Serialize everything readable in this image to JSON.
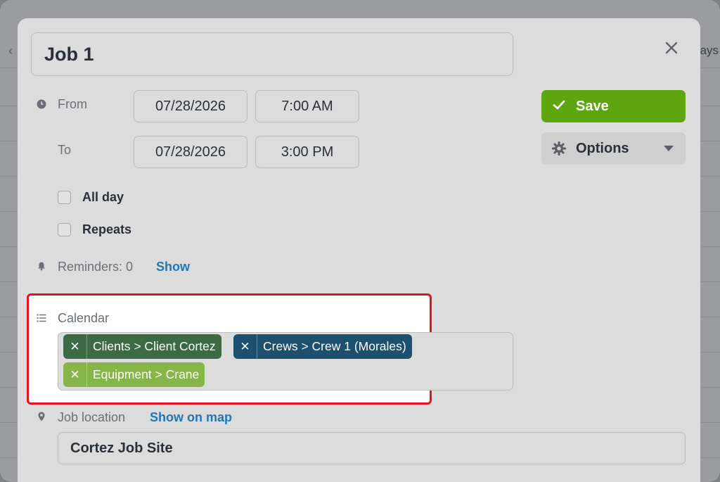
{
  "background": {
    "right_text": "ays"
  },
  "dialog": {
    "title": "Job 1",
    "from_label": "From",
    "to_label": "To",
    "from_date": "07/28/2026",
    "from_time": "7:00 AM",
    "to_date": "07/28/2026",
    "to_time": "3:00 PM",
    "all_day_label": "All day",
    "repeats_label": "Repeats",
    "reminders_label": "Reminders: 0",
    "reminders_link": "Show",
    "calendar_label": "Calendar",
    "calendar_tags": [
      {
        "label": "Clients > Client Cortez",
        "color": "#3b6a45"
      },
      {
        "label": "Crews > Crew 1 (Morales)",
        "color": "#1d4f6e"
      },
      {
        "label": "Equipment > Crane",
        "color": "#86b54a"
      }
    ],
    "job_location_label": "Job location",
    "show_on_map_link": "Show on map",
    "location_value": "Cortez Job Site"
  },
  "actions": {
    "save_label": "Save",
    "options_label": "Options"
  },
  "colors": {
    "save": "#5ea50f",
    "link": "#1f78b4",
    "highlight": "#e3141b"
  },
  "icons": [
    "close-icon",
    "clock-icon",
    "bell-icon",
    "list-icon",
    "location-pin-icon",
    "check-icon",
    "gear-icon",
    "caret-down-icon",
    "remove-tag-icon"
  ]
}
